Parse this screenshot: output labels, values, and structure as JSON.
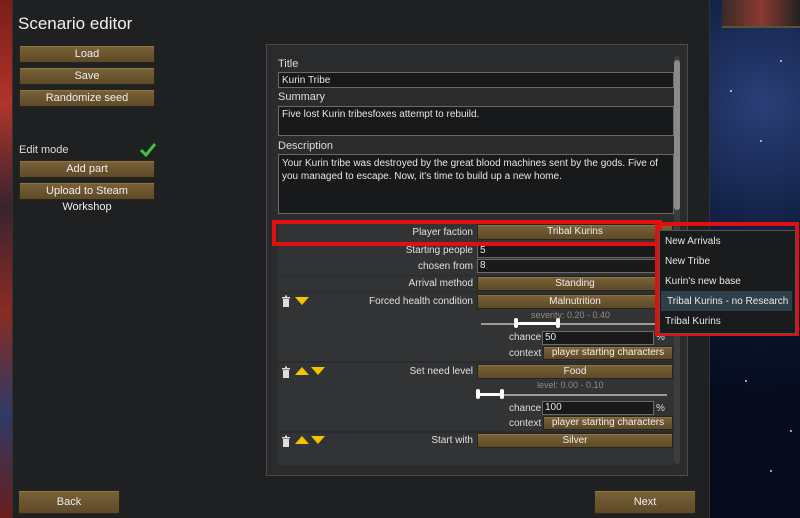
{
  "window": {
    "title": "Scenario editor"
  },
  "left": {
    "load_label": "Load",
    "save_label": "Save",
    "randomize_label": "Randomize seed",
    "edit_mode_label": "Edit mode",
    "add_part_label": "Add part",
    "upload_label": "Upload to Steam Workshop"
  },
  "form": {
    "title_label": "Title",
    "title_value": "Kurin Tribe",
    "summary_label": "Summary",
    "summary_value": "Five lost Kurin tribesfoxes attempt to rebuild.",
    "description_label": "Description",
    "description_value": "Your Kurin tribe was destroyed by the great blood machines sent by the gods. Five of you managed to escape. Now, it's time to build up a new home."
  },
  "parts": {
    "player_faction_label": "Player faction",
    "player_faction_value": "Tribal Kurins",
    "starting_people_label": "Starting people",
    "starting_people_value": "5",
    "chosen_from_label": "chosen from",
    "chosen_from_value": "8",
    "arrival_method_label": "Arrival method",
    "arrival_method_value": "Standing",
    "health_label": "Forced health condition",
    "health_value": "Malnutrition",
    "severity_label": "severity: 0.20 - 0.40",
    "severity_range": [
      0.2,
      0.4
    ],
    "chance_label": "chance",
    "health_chance_value": "50",
    "percent": "%",
    "context_label": "context",
    "health_context_value": "player starting characters",
    "need_label": "Set need level",
    "need_value": "Food",
    "need_level_label": "level: 0.00 - 0.10",
    "need_range": [
      0.0,
      0.1
    ],
    "need_chance_value": "100",
    "need_context_value": "player starting characters",
    "start_with_label": "Start with",
    "start_with_value": "Silver"
  },
  "dropdown": {
    "items": [
      "New Arrivals",
      "New Tribe",
      "Kurin's new base",
      "Tribal Kurins - no Research",
      "Tribal Kurins"
    ],
    "highlighted": "Tribal Kurins - no Research"
  },
  "footer": {
    "back_label": "Back",
    "next_label": "Next"
  },
  "colors": {
    "button": "#6b5530",
    "highlight_box": "#e01010",
    "panel": "#2a2b2c"
  }
}
